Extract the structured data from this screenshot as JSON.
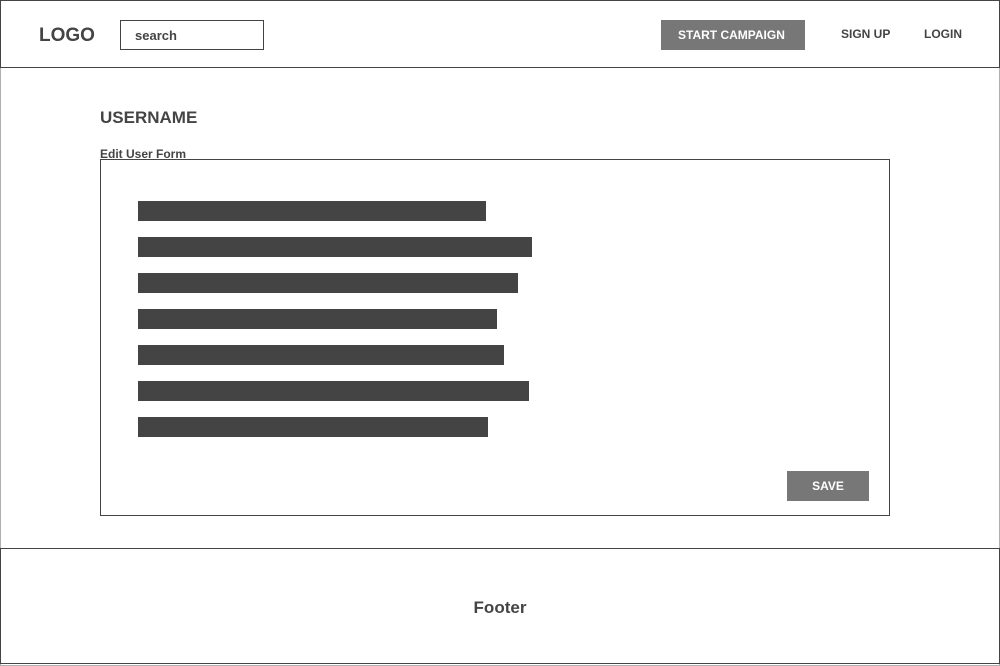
{
  "header": {
    "logo": "LOGO",
    "search_placeholder": "search",
    "start_campaign_label": "START CAMPAIGN",
    "sign_up_label": "SIGN UP",
    "login_label": "LOGIN"
  },
  "main": {
    "username": "USERNAME",
    "form_label": "Edit User Form",
    "field_count": 7,
    "save_label": "SAVE"
  },
  "footer": {
    "label": "Footer"
  },
  "colors": {
    "text": "#444444",
    "field_bar": "#444444",
    "button": "#777777",
    "button_text": "#ffffff"
  }
}
